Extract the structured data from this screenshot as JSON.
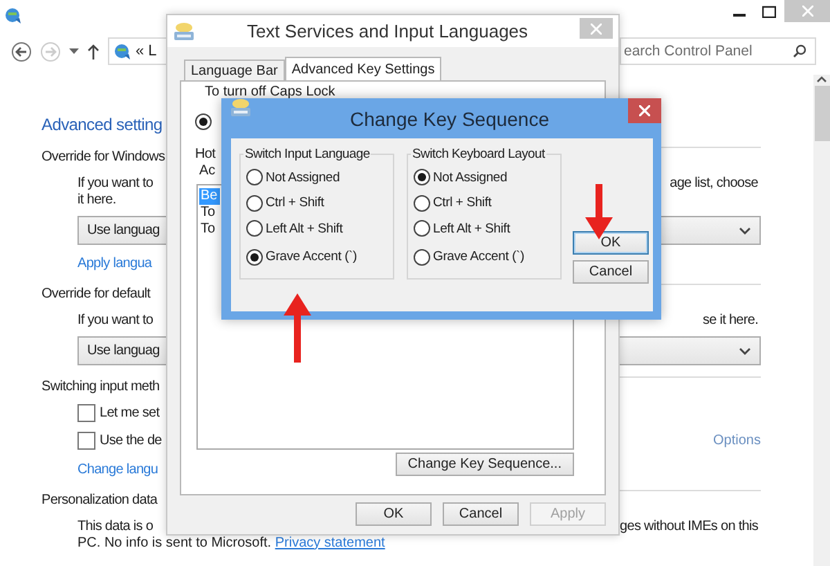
{
  "control_panel": {
    "address": {
      "chevrons": "«",
      "path": "L"
    },
    "search": {
      "placeholder": "earch Control Panel"
    },
    "rows": [
      {
        "kind": "heading",
        "text": "Advanced setting"
      },
      {
        "kind": "label",
        "text": "Override for Windows"
      },
      {
        "kind": "text",
        "text": "If you want to",
        "right": "age list, choose"
      },
      {
        "kind": "text",
        "text": "it here."
      },
      {
        "kind": "dropdown",
        "value": "Use languag"
      },
      {
        "kind": "link",
        "text": "Apply langua"
      },
      {
        "kind": "label",
        "text": "Override for default"
      },
      {
        "kind": "text",
        "text": "If you want to",
        "right": "se it here."
      },
      {
        "kind": "dropdown",
        "value": "Use languag"
      },
      {
        "kind": "label",
        "text": "Switching input meth"
      },
      {
        "kind": "checkbox",
        "text": "Let me set",
        "checked": false
      },
      {
        "kind": "checkbox",
        "text": "Use the de",
        "checked": false,
        "right": "Options"
      },
      {
        "kind": "link",
        "text": "Change langu"
      },
      {
        "kind": "label",
        "text": "Personalization data"
      },
      {
        "kind": "text",
        "text": "This data is o",
        "right": "ges without IMEs on this"
      },
      {
        "kind": "privacy",
        "text": "PC. No info is sent to Microsoft.",
        "link": "Privacy statement"
      }
    ]
  },
  "text_services": {
    "title": "Text Services and Input Languages",
    "tabs": [
      {
        "label": "Language Bar",
        "selected": false
      },
      {
        "label": "Advanced Key Settings",
        "selected": true
      }
    ],
    "caps_lock": {
      "label": "To turn off Caps Lock",
      "selected": true
    },
    "hotkeys_label": "Hot",
    "column_header": "Ac",
    "items": [
      {
        "text": "Be",
        "selected": true
      },
      {
        "text": "To",
        "selected": false
      },
      {
        "text": "To",
        "selected": false
      }
    ],
    "change_button": "Change Key Sequence...",
    "buttons": [
      {
        "label": "OK",
        "disabled": false
      },
      {
        "label": "Cancel",
        "disabled": false
      },
      {
        "label": "Apply",
        "disabled": true
      }
    ]
  },
  "change_key_sequence": {
    "title": "Change Key Sequence",
    "groups": [
      {
        "title": "Switch Input Language",
        "options": [
          {
            "label": "Not Assigned",
            "selected": false
          },
          {
            "label": "Ctrl + Shift",
            "selected": false
          },
          {
            "label": "Left Alt + Shift",
            "selected": false
          },
          {
            "label": "Grave Accent (`)",
            "selected": true
          }
        ]
      },
      {
        "title": "Switch Keyboard Layout",
        "options": [
          {
            "label": "Not Assigned",
            "selected": true
          },
          {
            "label": "Ctrl + Shift",
            "selected": false
          },
          {
            "label": "Left Alt + Shift",
            "selected": false
          },
          {
            "label": "Grave Accent (`)",
            "selected": false
          }
        ]
      }
    ],
    "buttons": [
      {
        "label": "OK",
        "default": true
      },
      {
        "label": "Cancel",
        "default": false
      }
    ]
  }
}
